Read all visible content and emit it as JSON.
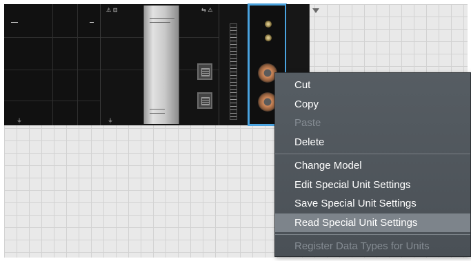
{
  "canvas": {
    "power_unit": {
      "top_label": "",
      "mid_label": ""
    },
    "cpu_unit": {
      "panel_label": "",
      "panel_sublabel": ""
    },
    "selected_unit": "special-unit"
  },
  "context_menu": {
    "groups": [
      {
        "items": [
          {
            "label": "Cut",
            "enabled": true
          },
          {
            "label": "Copy",
            "enabled": true
          },
          {
            "label": "Paste",
            "enabled": false
          },
          {
            "label": "Delete",
            "enabled": true
          }
        ]
      },
      {
        "items": [
          {
            "label": "Change Model",
            "enabled": true
          },
          {
            "label": "Edit Special Unit Settings",
            "enabled": true
          },
          {
            "label": "Save Special Unit Settings",
            "enabled": true
          },
          {
            "label": "Read Special Unit Settings",
            "enabled": true,
            "highlighted": true
          }
        ]
      },
      {
        "items": [
          {
            "label": "Register Data Types for Units",
            "enabled": false
          }
        ]
      }
    ]
  },
  "colors": {
    "selection_outline": "#4aa3df",
    "menu_background": "#51575d",
    "menu_highlight": "#7d848b",
    "menu_text": "#ffffff",
    "menu_disabled_text": "#858c93"
  }
}
